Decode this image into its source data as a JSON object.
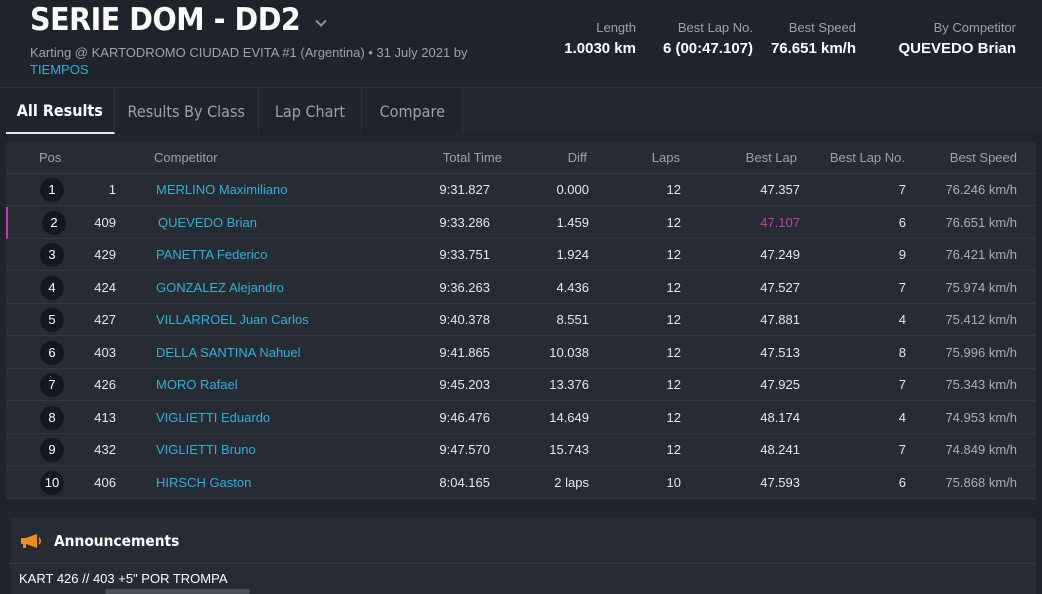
{
  "header": {
    "title": "SERIE DOM - DD2",
    "subtitle_prefix": "Karting @ KARTODROMO CIUDAD EVITA #1 (Argentina) • 31 July 2021 by",
    "subtitle_link": "TIEMPOS",
    "stats": {
      "length_label": "Length",
      "length_value": "1.0030 km",
      "best_lap_no_label": "Best Lap No.",
      "best_lap_no_value": "6 (00:47.107)",
      "best_speed_label": "Best Speed",
      "best_speed_value": "76.651 km/h",
      "by_competitor_label": "By Competitor",
      "by_competitor_value": "QUEVEDO Brian"
    }
  },
  "tabs": [
    {
      "label": "All Results",
      "active": true
    },
    {
      "label": "Results By Class",
      "active": false
    },
    {
      "label": "Lap Chart",
      "active": false
    },
    {
      "label": "Compare",
      "active": false
    }
  ],
  "table": {
    "columns": {
      "pos": "Pos",
      "competitor": "Competitor",
      "total_time": "Total Time",
      "diff": "Diff",
      "laps": "Laps",
      "best_lap": "Best Lap",
      "best_lap_no": "Best Lap No.",
      "best_speed": "Best Speed"
    },
    "rows": [
      {
        "pos": "1",
        "num": "1",
        "name": "MERLINO Maximiliano",
        "total": "9:31.827",
        "diff": "0.000",
        "laps": "12",
        "best": "47.357",
        "best_no": "7",
        "speed": "76.246 km/h"
      },
      {
        "pos": "2",
        "num": "409",
        "name": "QUEVEDO Brian",
        "total": "9:33.286",
        "diff": "1.459",
        "laps": "12",
        "best": "47.107",
        "best_no": "6",
        "speed": "76.651 km/h"
      },
      {
        "pos": "3",
        "num": "429",
        "name": "PANETTA Federico",
        "total": "9:33.751",
        "diff": "1.924",
        "laps": "12",
        "best": "47.249",
        "best_no": "9",
        "speed": "76.421 km/h"
      },
      {
        "pos": "4",
        "num": "424",
        "name": "GONZALEZ Alejandro",
        "total": "9:36.263",
        "diff": "4.436",
        "laps": "12",
        "best": "47.527",
        "best_no": "7",
        "speed": "75.974 km/h"
      },
      {
        "pos": "5",
        "num": "427",
        "name": "VILLARROEL Juan Carlos",
        "total": "9:40.378",
        "diff": "8.551",
        "laps": "12",
        "best": "47.881",
        "best_no": "4",
        "speed": "75.412 km/h"
      },
      {
        "pos": "6",
        "num": "403",
        "name": "DELLA SANTINA Nahuel",
        "total": "9:41.865",
        "diff": "10.038",
        "laps": "12",
        "best": "47.513",
        "best_no": "8",
        "speed": "75.996 km/h"
      },
      {
        "pos": "7",
        "num": "426",
        "name": "MORO Rafael",
        "total": "9:45.203",
        "diff": "13.376",
        "laps": "12",
        "best": "47.925",
        "best_no": "7",
        "speed": "75.343 km/h"
      },
      {
        "pos": "8",
        "num": "413",
        "name": "VIGLIETTI Eduardo",
        "total": "9:46.476",
        "diff": "14.649",
        "laps": "12",
        "best": "48.174",
        "best_no": "4",
        "speed": "74.953 km/h"
      },
      {
        "pos": "9",
        "num": "432",
        "name": "VIGLIETTI Bruno",
        "total": "9:47.570",
        "diff": "15.743",
        "laps": "12",
        "best": "48.241",
        "best_no": "7",
        "speed": "74.849 km/h"
      },
      {
        "pos": "10",
        "num": "406",
        "name": "HIRSCH Gaston",
        "total": "8:04.165",
        "diff": "2 laps",
        "laps": "10",
        "best": "47.593",
        "best_no": "6",
        "speed": "75.868 km/h"
      }
    ]
  },
  "announcements": {
    "title": "Announcements",
    "text": "KART 426 // 403 +5\" POR TROMPA"
  },
  "colors": {
    "background": "#1f242c",
    "panel": "#262b34",
    "link": "#2fb1d6",
    "best_lap_highlight": "#c43bb7",
    "megaphone": "#f08a1c"
  }
}
